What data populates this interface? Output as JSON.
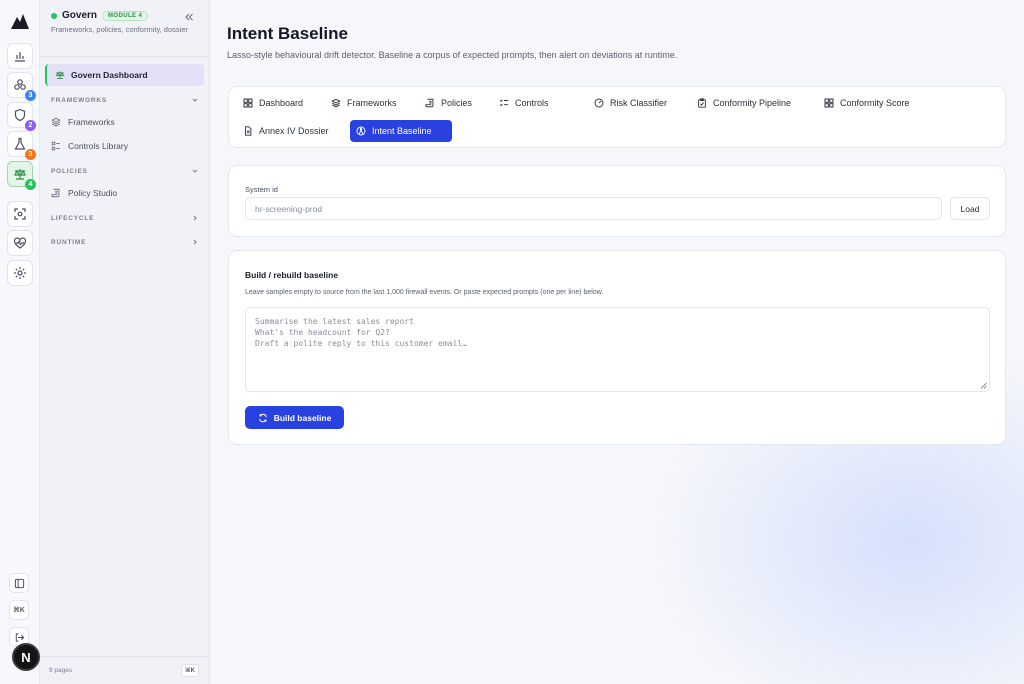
{
  "rail": {
    "badges": {
      "b1": "3",
      "b2": "2",
      "b3": "3",
      "b4": "4"
    },
    "shortcut": "⌘K",
    "avatar_letter": "N"
  },
  "sidebar": {
    "title": "Govern",
    "module_badge": "MODULE 4",
    "subtitle": "Frameworks, policies, conformity, dossier",
    "active_item": "Govern Dashboard",
    "sections": {
      "frameworks": "FRAMEWORKS",
      "policies": "POLICIES",
      "lifecycle": "LIFECYCLE",
      "runtime": "RUNTIME"
    },
    "items": {
      "frameworks": "Frameworks",
      "controls_library": "Controls Library",
      "policy_studio": "Policy Studio"
    },
    "footer_pages": "9 pages",
    "footer_shortcut": "⌘K"
  },
  "main": {
    "title": "Intent Baseline",
    "subtitle": "Lasso-style behavioural drift detector. Baseline a corpus of expected prompts, then alert on deviations at runtime.",
    "tabs": [
      {
        "label": "Dashboard"
      },
      {
        "label": "Frameworks"
      },
      {
        "label": "Policies"
      },
      {
        "label": "Controls"
      },
      {
        "label": "Risk Classifier"
      },
      {
        "label": "Conformity Pipeline"
      },
      {
        "label": "Conformity Score"
      },
      {
        "label": "Annex IV Dossier"
      },
      {
        "label": "Intent Baseline"
      }
    ],
    "system": {
      "label": "System id",
      "placeholder": "hr-screening-prod",
      "load_label": "Load"
    },
    "build": {
      "title": "Build / rebuild baseline",
      "description": "Leave samples empty to source from the last 1,000 firewall events. Or paste expected prompts (one per line) below.",
      "placeholder": "Summarise the latest sales report\nWhat's the headcount for Q2?\nDraft a polite reply to this customer email…",
      "button_label": "Build baseline"
    }
  },
  "colors": {
    "accent": "#2841e0",
    "brand_green": "#22c55e"
  }
}
